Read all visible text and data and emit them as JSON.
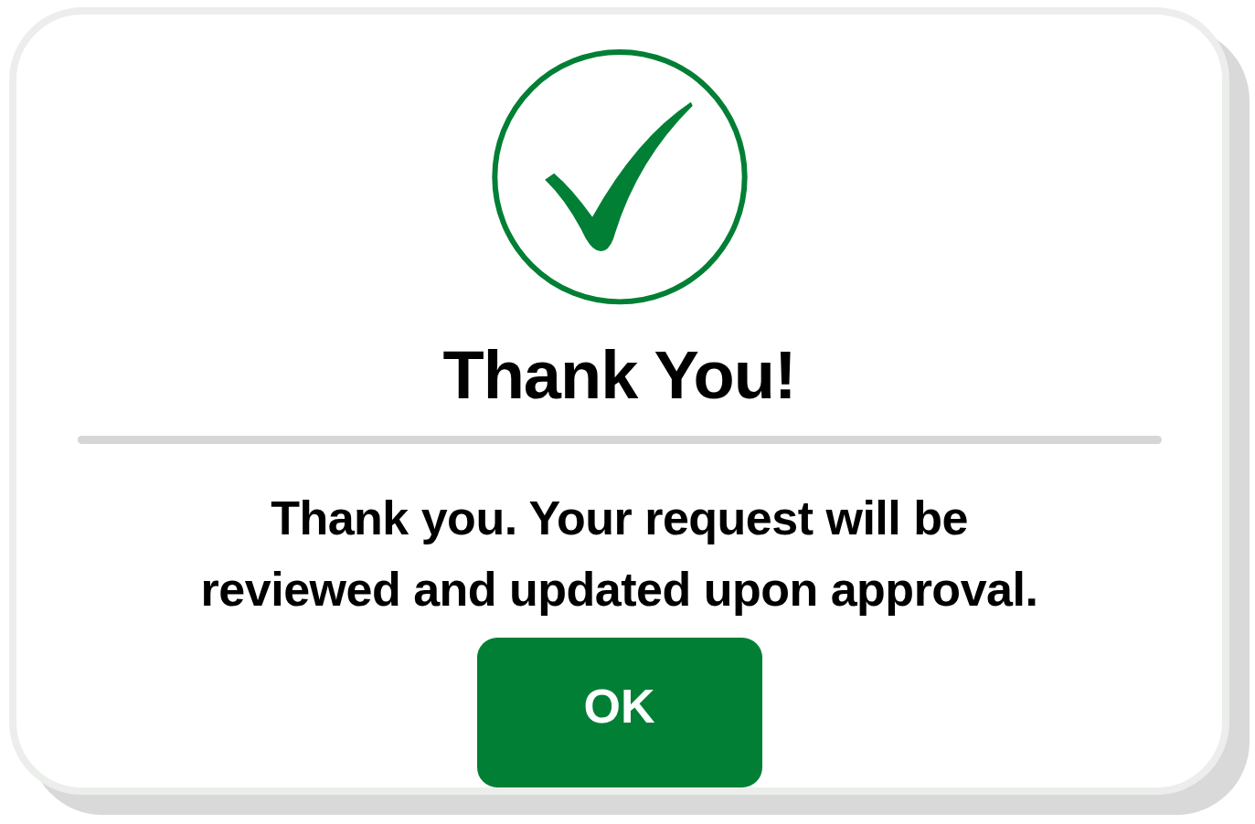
{
  "dialog": {
    "title": "Thank You!",
    "message_lines": [
      "Thank you. Your request will be",
      "reviewed and updated upon approval."
    ],
    "button": "OK"
  }
}
